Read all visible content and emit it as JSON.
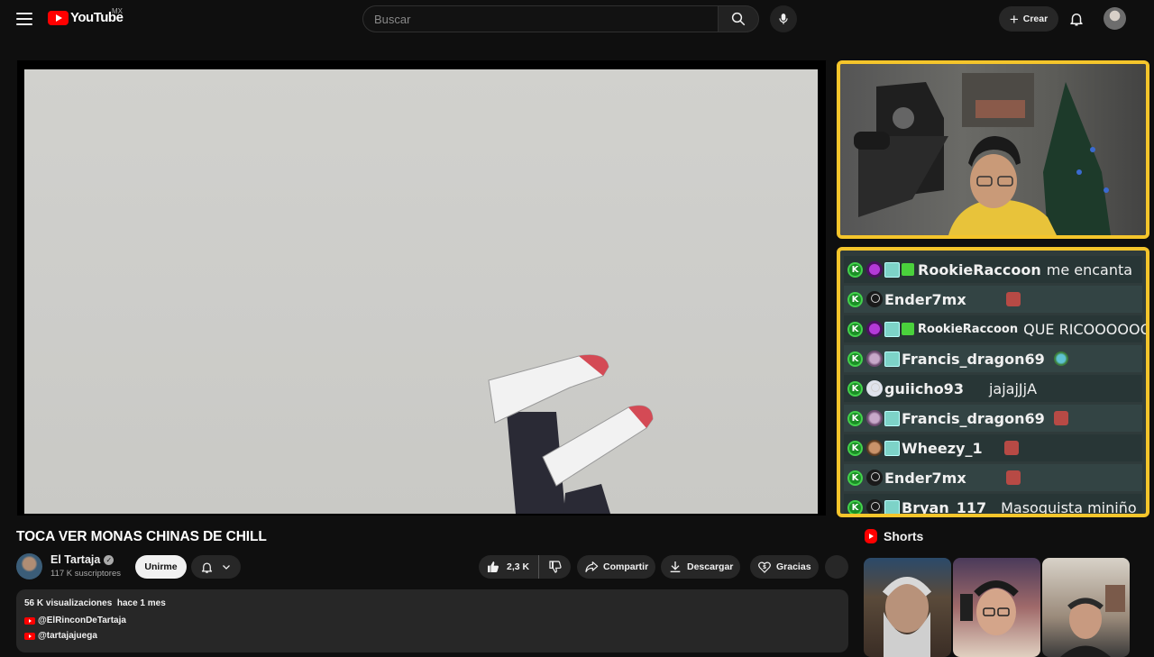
{
  "header": {
    "logo_text": "YouTube",
    "region": "MX",
    "search_placeholder": "Buscar",
    "create_label": "Crear"
  },
  "chat": {
    "messages": [
      {
        "user": "RookieRaccoon",
        "text": "me encanta"
      },
      {
        "user": "Ender7mx",
        "text": ""
      },
      {
        "user": "RookieRaccoon",
        "text": "QUE RICOOOOOOO"
      },
      {
        "user": "Francis_dragon69",
        "text": ""
      },
      {
        "user": "guiicho93",
        "text": "jajajJjA"
      },
      {
        "user": "Francis_dragon69",
        "text": ""
      },
      {
        "user": "Wheezy_1",
        "text": ""
      },
      {
        "user": "Ender7mx",
        "text": ""
      },
      {
        "user": "Bryan_117",
        "text": "Masoquista miniño"
      }
    ],
    "badge_letter": "K"
  },
  "video": {
    "title": "TOCA VER MONAS CHINAS DE CHILL",
    "channel_name": "El Tartaja",
    "subscribers": "117 K suscriptores",
    "join_label": "Unirme",
    "likes": "2,3 K",
    "share_label": "Compartir",
    "download_label": "Descargar",
    "thanks_label": "Gracias"
  },
  "description": {
    "views": "56 K visualizaciones",
    "age": "hace 1 mes",
    "links": [
      "@ElRinconDeTartaja",
      "@tartajajuega"
    ]
  },
  "shorts": {
    "heading": "Shorts"
  },
  "colors": {
    "background": "#0f0f0f",
    "overlay_border": "#f5c52b",
    "brand_red": "#ff0000",
    "chat_badge": "#1b8f26"
  }
}
